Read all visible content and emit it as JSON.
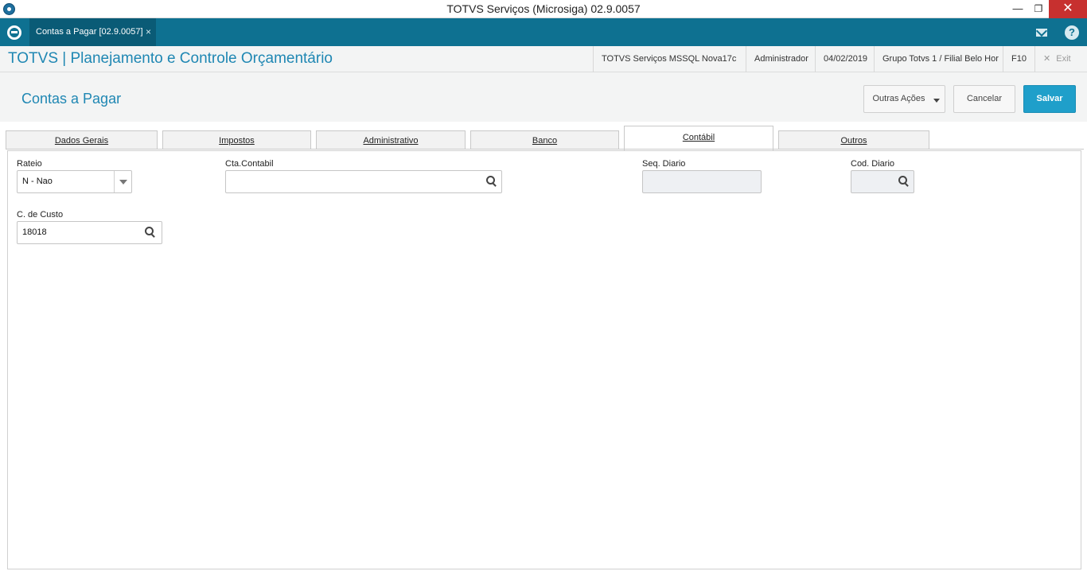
{
  "window": {
    "title": "TOTVS Serviços (Microsiga) 02.9.0057",
    "minimize_glyph": "—",
    "maximize_glyph": "❐",
    "close_glyph": "✕"
  },
  "app_tabs": {
    "active_doc_tab": "Contas a Pagar [02.9.0057]",
    "close_glyph": "×"
  },
  "module": {
    "title": "TOTVS | Planejamento e Controle Orçamentário",
    "environment": "TOTVS Serviços MSSQL Nova17c",
    "user": "Administrador",
    "date": "04/02/2019",
    "branch": "Grupo Totvs 1 / Filial Belo Hor",
    "shortcut": "F10",
    "exit_label": "Exit",
    "exit_glyph": "✕"
  },
  "page": {
    "title": "Contas a Pagar",
    "more_actions_label": "Outras Ações",
    "cancel_label": "Cancelar",
    "save_label": "Salvar"
  },
  "tabs": [
    {
      "label": "Dados Gerais",
      "active": false
    },
    {
      "label": "Impostos",
      "active": false
    },
    {
      "label": "Administrativo",
      "active": false
    },
    {
      "label": "Banco",
      "active": false
    },
    {
      "label": "Contábil",
      "active": true
    },
    {
      "label": "Outros",
      "active": false
    }
  ],
  "form": {
    "rateio": {
      "label": "Rateio",
      "value": "N - Nao"
    },
    "cta_contabil": {
      "label": "Cta.Contabil",
      "value": ""
    },
    "seq_diario": {
      "label": "Seq. Diario",
      "value": ""
    },
    "cod_diario": {
      "label": "Cod. Diario",
      "value": ""
    },
    "centro_custo": {
      "label": "C. de Custo",
      "value": "18018"
    }
  },
  "colors": {
    "header_teal": "#0e7191",
    "accent_blue": "#1f87b3",
    "save_button": "#1f9fca",
    "window_close": "#c7302f"
  },
  "icons": [
    "app-logo-icon",
    "mail-icon",
    "help-icon",
    "search-icon",
    "dropdown-arrow-icon"
  ]
}
